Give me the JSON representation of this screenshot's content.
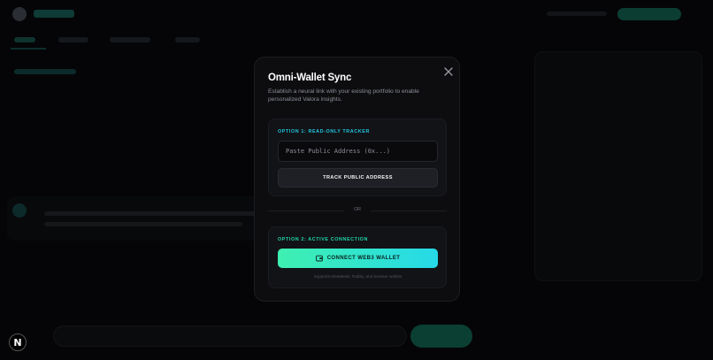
{
  "modal": {
    "title": "Omni-Wallet Sync",
    "description": "Establish a neural link with your existing portfolio to enable personalized Valora insights.",
    "option1": {
      "label": "OPTION 1: READ-ONLY TRACKER",
      "input_placeholder": "Paste Public Address (0x...)",
      "input_value": "",
      "button_label": "TRACK PUBLIC ADDRESS"
    },
    "divider": "OR",
    "option2": {
      "label": "OPTION 2: ACTIVE CONNECTION",
      "button_label": "CONNECT WEB3 WALLET",
      "button_icon": "wallet-icon",
      "supports_text": "Supports MetaMask, Rabby, and browser wallets."
    },
    "close_icon": "close-icon"
  },
  "framework_badge": {
    "letter": "N"
  },
  "colors": {
    "accent_cyan": "#22c6e0",
    "accent_green": "#1fd4a8",
    "gradient_start": "#3ef0b0",
    "gradient_end": "#26d9e8",
    "modal_bg": "#0d0d10"
  }
}
